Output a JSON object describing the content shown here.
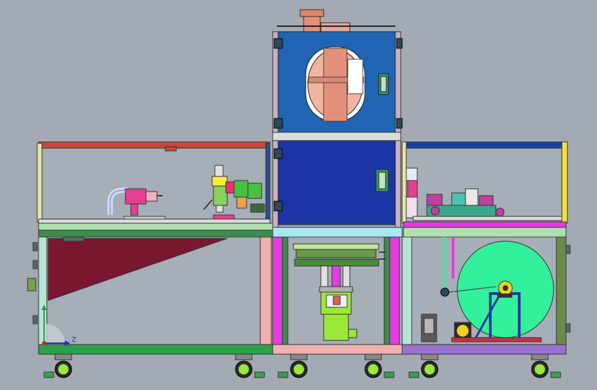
{
  "viewport": {
    "background": "#a3aab4",
    "triad": {
      "z_label": "Z"
    }
  },
  "colors": {
    "panel_blue": "#1f65b4",
    "panel_navy": "#1c35a6",
    "reel_green": "#33f09a",
    "frame_magenta": "#e43ce0",
    "frame_green": "#2aa24a",
    "frame_pink": "#f0b0ac",
    "guard_maroon": "#7a1730",
    "bracket_lime": "#9ae83a",
    "tube_copper": "#e2917a"
  }
}
